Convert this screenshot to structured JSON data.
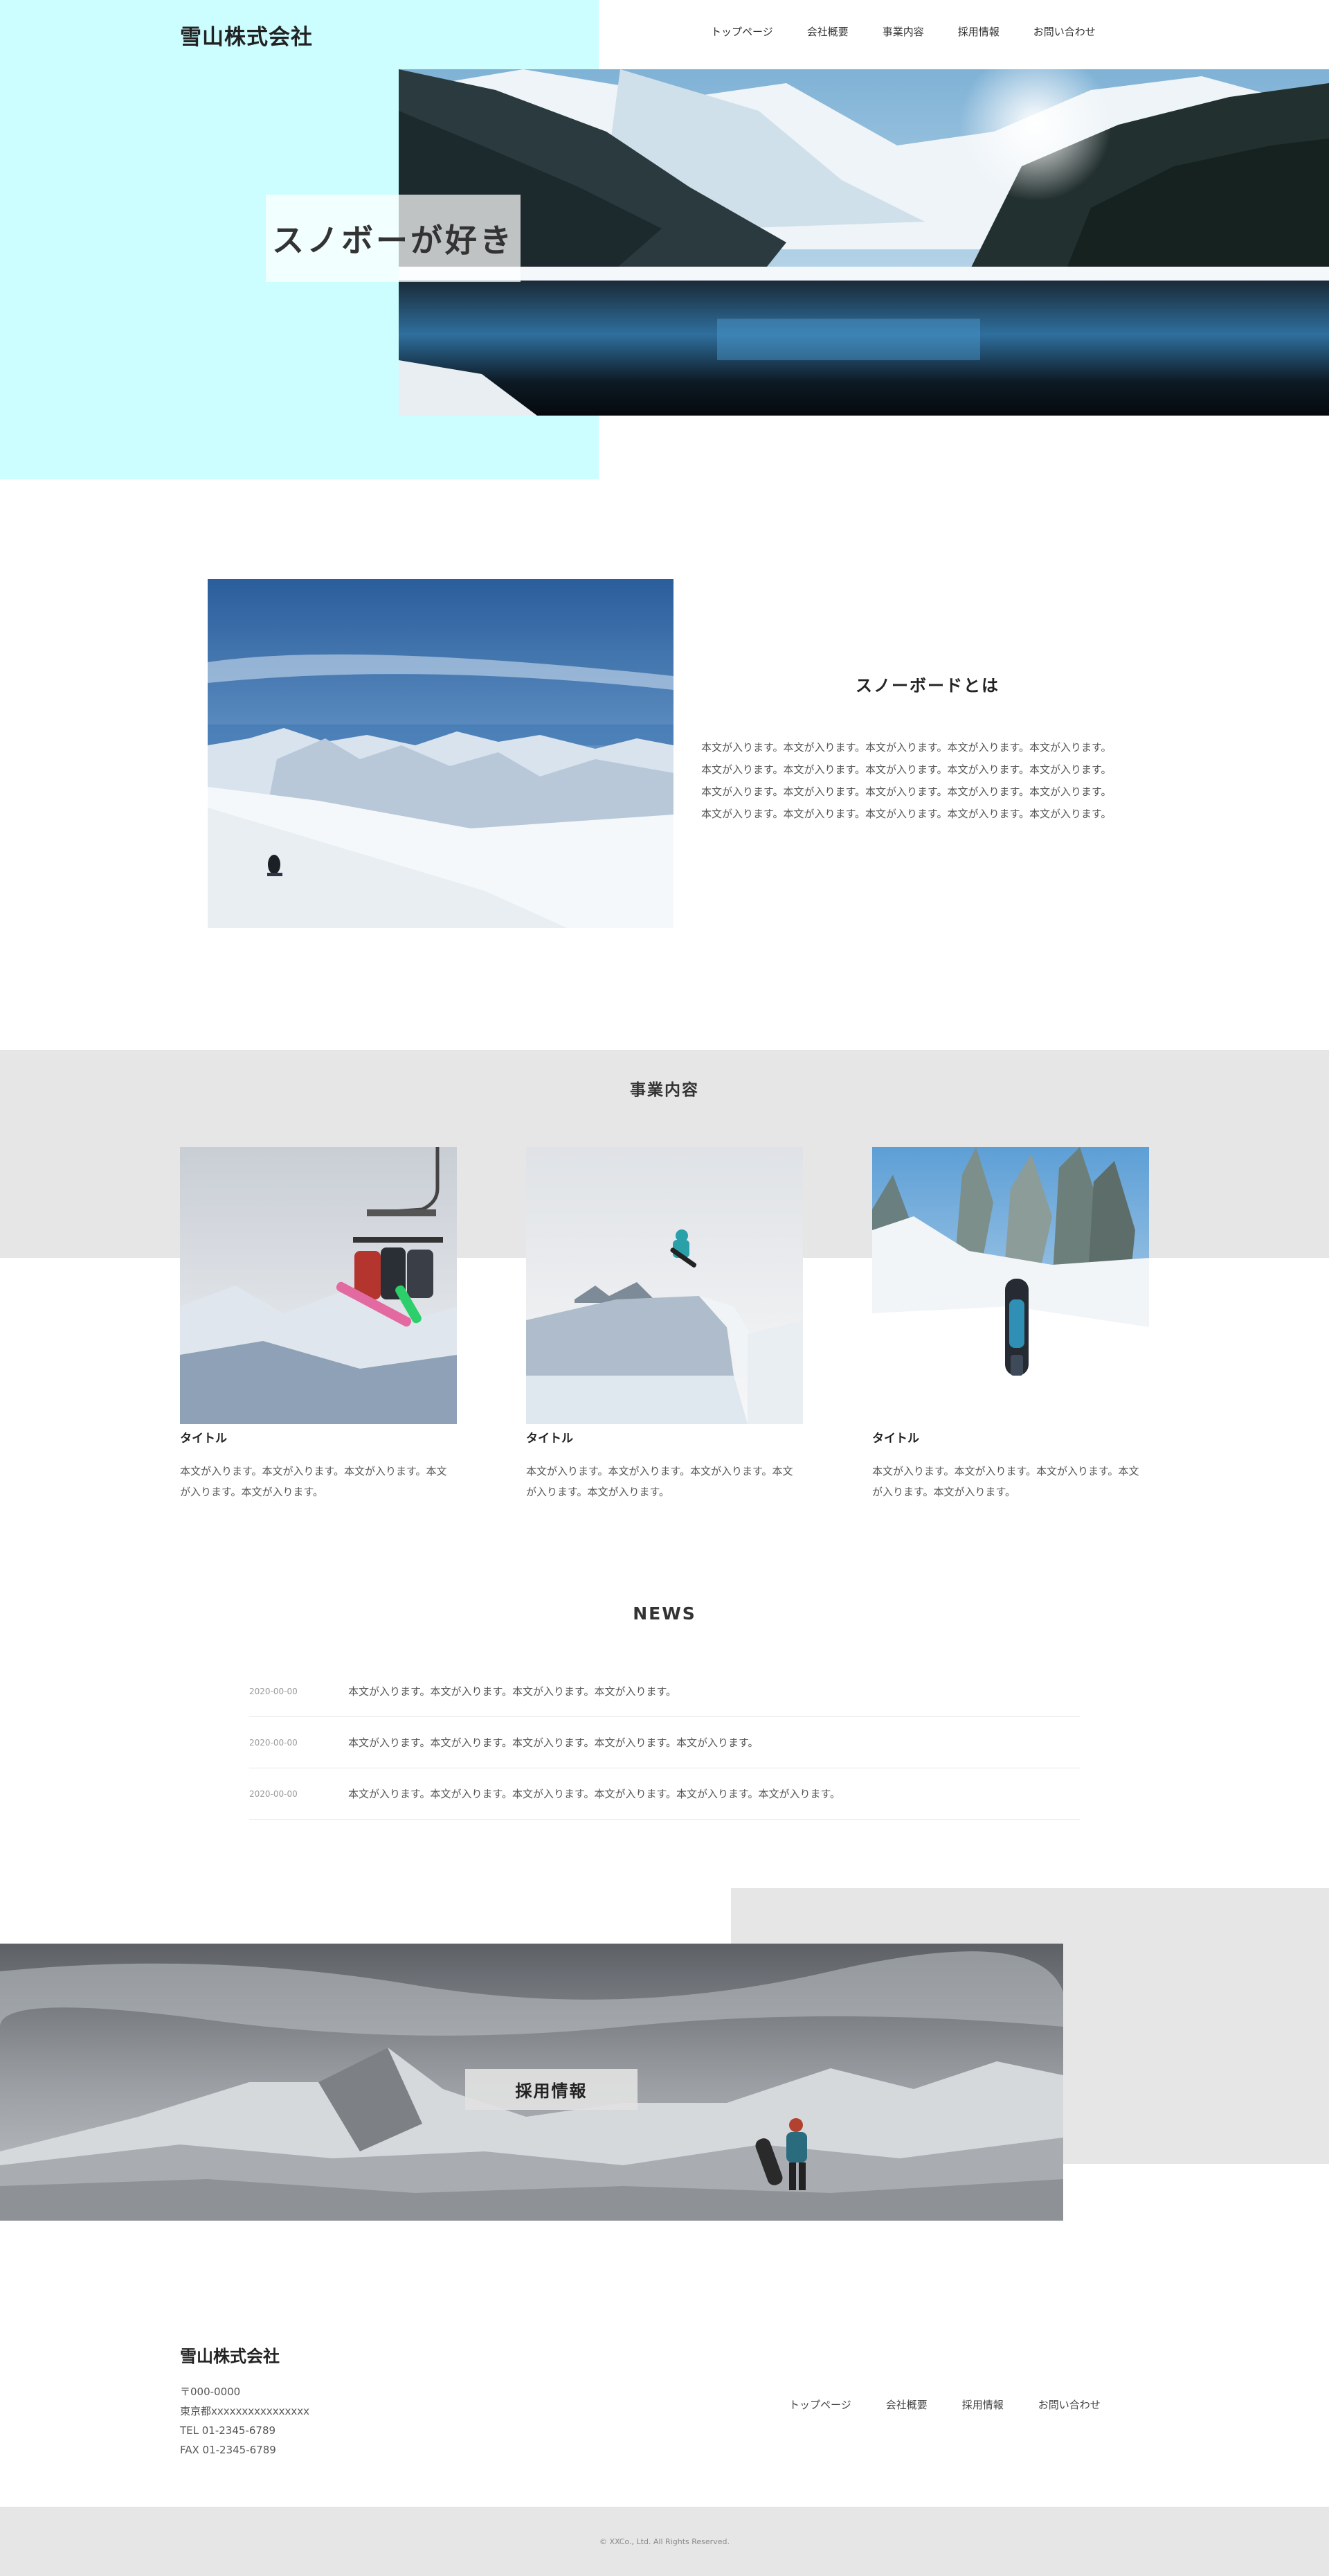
{
  "header": {
    "logo": "雪山株式会社",
    "nav": [
      "トップページ",
      "会社概要",
      "事業内容",
      "採用情報",
      "お問い合わせ"
    ]
  },
  "hero": {
    "title": "スノボーが好き"
  },
  "about": {
    "title": "スノーボードとは",
    "lines": [
      "本文が入ります。本文が入ります。本文が入ります。本文が入ります。本文が入ります。",
      "本文が入ります。本文が入ります。本文が入ります。本文が入ります。本文が入ります。",
      "本文が入ります。本文が入ります。本文が入ります。本文が入ります。本文が入ります。",
      "本文が入ります。本文が入ります。本文が入ります。本文が入ります。本文が入ります。"
    ]
  },
  "services": {
    "heading": "事業内容",
    "cards": [
      {
        "title": "タイトル",
        "text": "本文が入ります。本文が入ります。本文が入ります。本文が入ります。本文が入ります。"
      },
      {
        "title": "タイトル",
        "text": "本文が入ります。本文が入ります。本文が入ります。本文が入ります。本文が入ります。"
      },
      {
        "title": "タイトル",
        "text": "本文が入ります。本文が入ります。本文が入ります。本文が入ります。本文が入ります。"
      }
    ]
  },
  "news": {
    "heading": "NEWS",
    "items": [
      {
        "date": "2020-00-00",
        "text": "本文が入ります。本文が入ります。本文が入ります。本文が入ります。"
      },
      {
        "date": "2020-00-00",
        "text": "本文が入ります。本文が入ります。本文が入ります。本文が入ります。本文が入ります。"
      },
      {
        "date": "2020-00-00",
        "text": "本文が入ります。本文が入ります。本文が入ります。本文が入ります。本文が入ります。本文が入ります。"
      }
    ]
  },
  "recruit": {
    "label": "採用情報"
  },
  "footer": {
    "logo": "雪山株式会社",
    "address": [
      "〒000-0000",
      "東京都xxxxxxxxxxxxxxxx",
      "TEL 01-2345-6789",
      "FAX 01-2345-6789"
    ],
    "nav": [
      "トップページ",
      "会社概要",
      "採用情報",
      "お問い合わせ"
    ],
    "copyright": "© XXCo., Ltd. All Rights Reserved."
  }
}
